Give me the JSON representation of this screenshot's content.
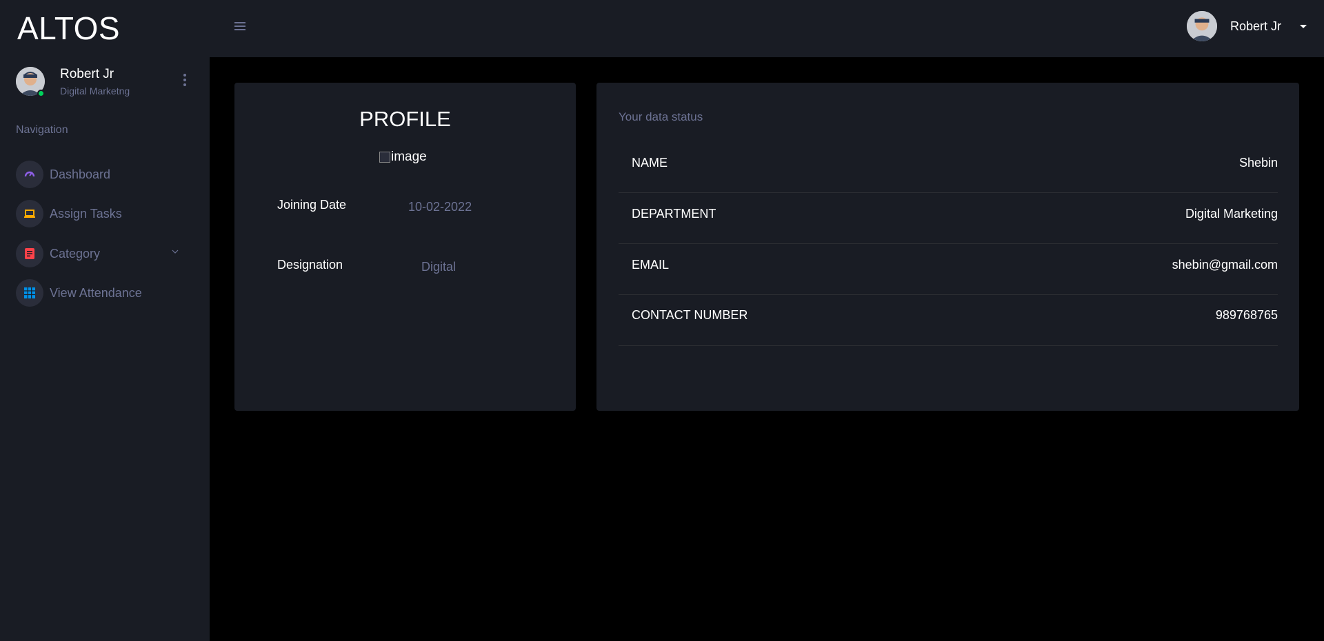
{
  "brand": "ALTOS",
  "sidebar": {
    "user": {
      "name": "Robert Jr",
      "role": "Digital Marketng"
    },
    "nav_heading": "Navigation",
    "items": [
      {
        "label": "Dashboard",
        "icon": "speedometer-icon",
        "icon_color": "#8f5fe8"
      },
      {
        "label": "Assign Tasks",
        "icon": "laptop-icon",
        "icon_color": "#ffab00"
      },
      {
        "label": "Category",
        "icon": "list-icon",
        "icon_color": "#fc424a"
      },
      {
        "label": "View Attendance",
        "icon": "table-icon",
        "icon_color": "#0090e7"
      }
    ]
  },
  "topbar": {
    "user_name": "Robert Jr"
  },
  "profile_card": {
    "title": "PROFILE",
    "image_alt": "image",
    "fields": [
      {
        "label": "Joining Date",
        "value": "10-02-2022"
      },
      {
        "label": "Designation",
        "value": "Digital"
      }
    ]
  },
  "status_card": {
    "heading": "Your data status",
    "rows": [
      {
        "key": "NAME",
        "value": "Shebin"
      },
      {
        "key": "DEPARTMENT",
        "value": "Digital Marketing"
      },
      {
        "key": "EMAIL",
        "value": "shebin@gmail.com"
      },
      {
        "key": "CONTACT NUMBER",
        "value": "989768765"
      }
    ]
  },
  "colors": {
    "sidebar_bg": "#191c24",
    "content_bg": "#000000",
    "muted_text": "#6c7293",
    "online": "#00d25b"
  }
}
